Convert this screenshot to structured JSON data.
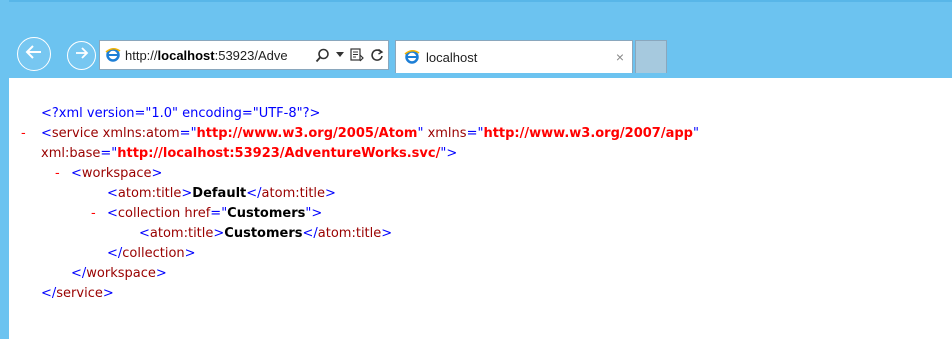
{
  "browser": {
    "address_prefix": "http://",
    "address_host": "localhost",
    "address_rest": ":53923/Adve",
    "tab_title": "localhost",
    "tab_close": "×"
  },
  "xml": {
    "decl": "<?xml version=\"1.0\" encoding=\"UTF-8\"?>",
    "toggle": "-",
    "service_open": "<",
    "service_name": "service",
    "service_attr1_name": "xmlns:atom",
    "service_attr1_value": "http://www.w3.org/2005/Atom",
    "service_attr2_name": "xmlns",
    "service_attr2_value": "http://www.w3.org/2007/app",
    "service_attr3_name": "xml:base",
    "service_attr3_value": "http://localhost:53923/AdventureWorks.svc/",
    "workspace_name": "workspace",
    "atom_title": "atom:title",
    "workspace_title": "Default",
    "collection_name": "collection",
    "collection_attr_name": "href",
    "collection_attr_value": "Customers",
    "collection_title": "Customers",
    "service_close": "service",
    "workspace_close": "workspace",
    "collection_close": "collection"
  }
}
